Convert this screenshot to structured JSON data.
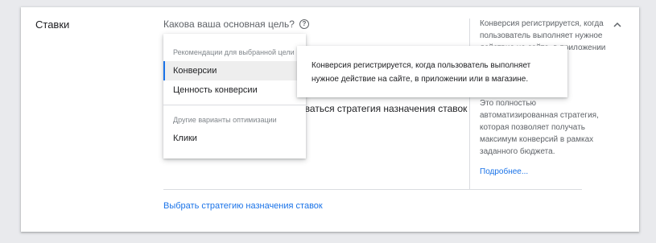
{
  "section": {
    "title": "Ставки",
    "question": "Какова ваша основная цель?",
    "help_icon": "question-circle-icon",
    "strategy_text": "оваться стратегия назначения ставок",
    "choose_strategy_link": "Выбрать стратегию назначения ставок"
  },
  "dropdown": {
    "recommended_header": "Рекомендации для выбранной цели",
    "recommended_items": [
      {
        "label": "Конверсии",
        "selected": true
      },
      {
        "label": "Ценность конверсии",
        "selected": false
      }
    ],
    "other_header": "Другие варианты оптимизации",
    "other_items": [
      {
        "label": "Клики",
        "selected": false
      }
    ]
  },
  "tooltip": {
    "text": "Конверсия регистрируется, когда пользователь выполняет нужное действие на сайте, в приложении или в магазине."
  },
  "side_panel": {
    "top_text": "Конверсия регистрируется, когда пользователь выполняет нужное действие на сайте, в приложении или в магазине.",
    "mid_text": "Это полностью автоматизированная стратегия, которая позволяет получать максимум конверсий в рамках заданного бюджета.",
    "more_link": "Подробнее...",
    "collapse_icon": "chevron-up-icon"
  },
  "colors": {
    "accent": "#1a73e8",
    "selected_bg": "#eeeeee",
    "page_bg": "#e9eaed"
  }
}
